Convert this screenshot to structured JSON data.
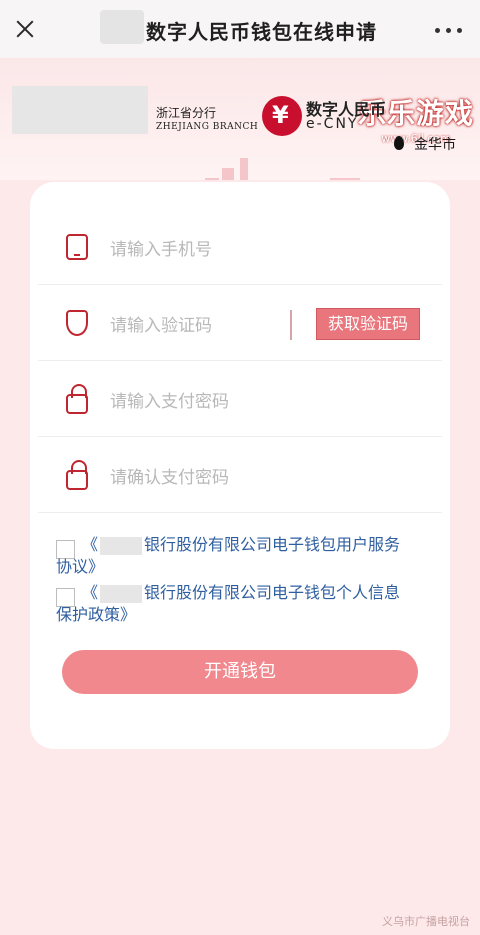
{
  "header": {
    "title": "数字人民币钱包在线申请",
    "close_icon": "close-icon",
    "more_icon": "more-icon"
  },
  "banner": {
    "branch_cn": "浙江省分行",
    "branch_en": "ZHEJIANG BRANCH",
    "ecny_cn": "数字人民币",
    "ecny_en": "e-CNY",
    "location": "金华市",
    "watermark_main": "乐乐游戏",
    "watermark_sub": "www.6ll.com"
  },
  "form": {
    "phone_placeholder": "请输入手机号",
    "code_placeholder": "请输入验证码",
    "get_code_label": "获取验证码",
    "password_placeholder": "请输入支付密码",
    "confirm_placeholder": "请确认支付密码"
  },
  "agreements": {
    "item1_prefix": "《",
    "item1_text": "银行股份有限公司电子钱包用户服务",
    "item1_line2": "协议》",
    "item2_prefix": "《",
    "item2_text": "银行股份有限公司电子钱包个人信息",
    "item2_line2": "保护政策》"
  },
  "submit_label": "开通钱包",
  "footer": "义乌市广播电视台",
  "colors": {
    "accent": "#c0262f",
    "button": "#f0888d",
    "link": "#2f5fa0",
    "background": "#fde9ea"
  }
}
